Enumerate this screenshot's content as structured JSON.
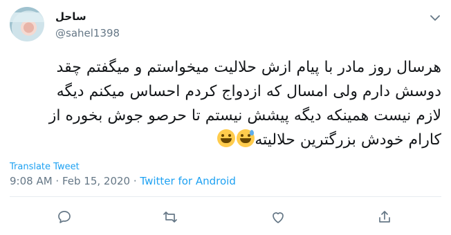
{
  "user": {
    "display_name": "ساحل",
    "handle": "@sahel1398",
    "avatar_icon": "profile-photo"
  },
  "tweet": {
    "lines": [
      "هرسال روز مادر با پیام ازش حلالیت میخواستم و میگفتم چقد",
      "دوسش دارم ولی امسال که ازدواج کردم احساس میکنم دیگه",
      "لازم نیست همینکه دیگه پیشش نیستم تا حرصو جوش بخوره از",
      "کارام خودش بزرگترین حلالیته"
    ],
    "emojis": [
      "grinning-face-with-sweat",
      "grinning-face"
    ]
  },
  "translate_label": "Translate Tweet",
  "meta": {
    "time": "9:08 AM",
    "separator": " · ",
    "date": "Feb 15, 2020",
    "source": "Twitter for Android"
  },
  "actions": [
    {
      "icon": "reply-icon"
    },
    {
      "icon": "retweet-icon"
    },
    {
      "icon": "like-icon"
    },
    {
      "icon": "share-icon"
    }
  ],
  "colors": {
    "link": "#1da1f2",
    "secondary_text": "#657786",
    "primary_text": "#14171a",
    "divider": "#e6ecf0"
  }
}
